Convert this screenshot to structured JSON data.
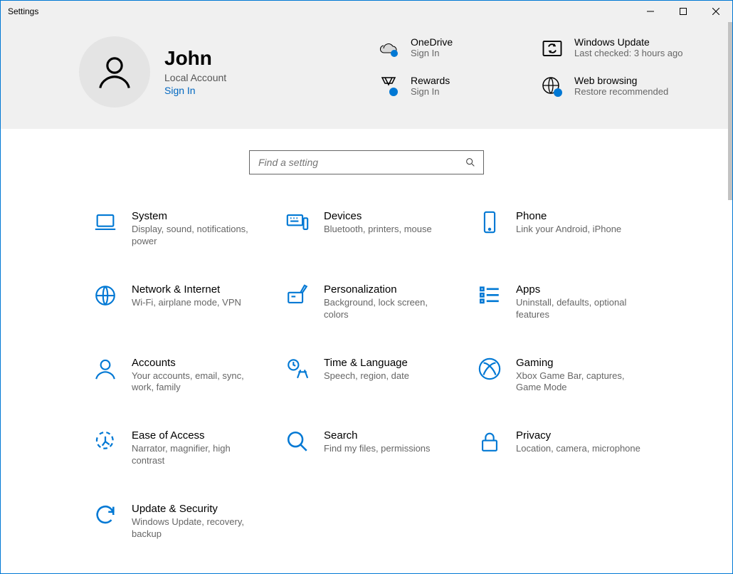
{
  "window": {
    "title": "Settings"
  },
  "account": {
    "name": "John",
    "role": "Local Account",
    "signin": "Sign In"
  },
  "tiles": [
    {
      "id": "onedrive",
      "title": "OneDrive",
      "sub": "Sign In"
    },
    {
      "id": "windowsupdate",
      "title": "Windows Update",
      "sub": "Last checked: 3 hours ago"
    },
    {
      "id": "rewards",
      "title": "Rewards",
      "sub": "Sign In"
    },
    {
      "id": "webbrowsing",
      "title": "Web browsing",
      "sub": "Restore recommended"
    }
  ],
  "search": {
    "placeholder": "Find a setting"
  },
  "categories": [
    {
      "id": "system",
      "title": "System",
      "sub": "Display, sound, notifications, power"
    },
    {
      "id": "devices",
      "title": "Devices",
      "sub": "Bluetooth, printers, mouse"
    },
    {
      "id": "phone",
      "title": "Phone",
      "sub": "Link your Android, iPhone"
    },
    {
      "id": "network",
      "title": "Network & Internet",
      "sub": "Wi-Fi, airplane mode, VPN"
    },
    {
      "id": "personalization",
      "title": "Personalization",
      "sub": "Background, lock screen, colors"
    },
    {
      "id": "apps",
      "title": "Apps",
      "sub": "Uninstall, defaults, optional features"
    },
    {
      "id": "accounts",
      "title": "Accounts",
      "sub": "Your accounts, email, sync, work, family"
    },
    {
      "id": "time",
      "title": "Time & Language",
      "sub": "Speech, region, date"
    },
    {
      "id": "gaming",
      "title": "Gaming",
      "sub": "Xbox Game Bar, captures, Game Mode"
    },
    {
      "id": "ease",
      "title": "Ease of Access",
      "sub": "Narrator, magnifier, high contrast"
    },
    {
      "id": "search",
      "title": "Search",
      "sub": "Find my files, permissions"
    },
    {
      "id": "privacy",
      "title": "Privacy",
      "sub": "Location, camera, microphone"
    },
    {
      "id": "update",
      "title": "Update & Security",
      "sub": "Windows Update, recovery, backup"
    }
  ]
}
